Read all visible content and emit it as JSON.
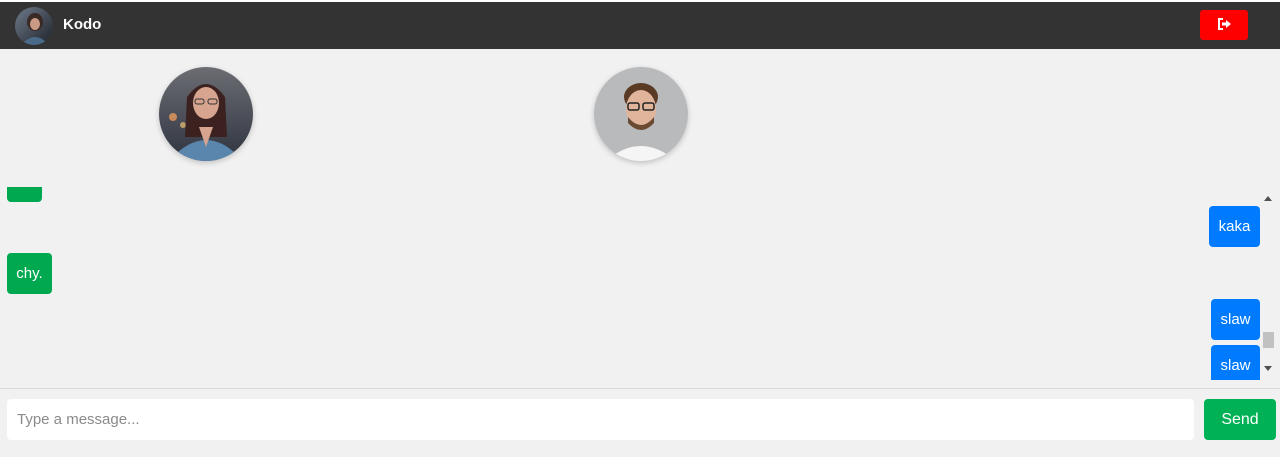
{
  "header": {
    "title": "Kodo",
    "avatar_icon": "user-avatar",
    "logout_icon": "sign-out-icon",
    "logout_color": "#ff0000",
    "background": "#333333"
  },
  "participants": [
    {
      "name": "participant-woman-avatar"
    },
    {
      "name": "participant-man-avatar"
    }
  ],
  "messages": [
    {
      "side": "left",
      "text": "",
      "color": "#00a84f"
    },
    {
      "side": "right",
      "text": "kaka",
      "color": "#007bff"
    },
    {
      "side": "left",
      "text": "chy.",
      "color": "#00a84f"
    },
    {
      "side": "right",
      "text": "slaw",
      "color": "#007bff"
    },
    {
      "side": "right",
      "text": "slaw",
      "color": "#007bff"
    }
  ],
  "composer": {
    "placeholder": "Type a message...",
    "value": "",
    "send_label": "Send",
    "send_color": "#00b156"
  }
}
